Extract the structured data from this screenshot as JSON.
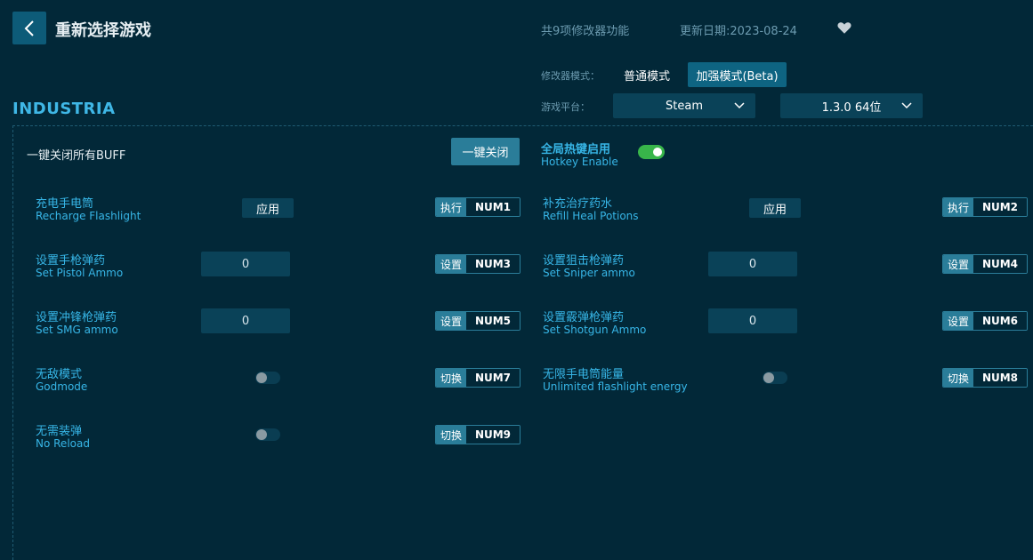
{
  "header": {
    "title": "重新选择游戏",
    "feature_count": "共9项修改器功能",
    "update_date": "更新日期:2023-08-24"
  },
  "mode": {
    "label": "修改器模式：",
    "normal": "普通模式",
    "enhanced": "加强模式(Beta)"
  },
  "platform": {
    "label": "游戏平台：",
    "selected": "Steam",
    "version": "1.3.0 64位"
  },
  "game_name": "INDUSTRIA",
  "disable_all": {
    "label": "一键关闭所有BUFF",
    "button": "一键关闭"
  },
  "hotkey_enable": {
    "cn": "全局热键启用",
    "en": "Hotkey Enable",
    "enabled": true
  },
  "apply_label": "应用",
  "options": [
    {
      "cn": "充电手电筒",
      "en": "Recharge Flashlight",
      "action": "执行",
      "key": "NUM1",
      "control": "apply"
    },
    {
      "cn": "补充治疗药水",
      "en": "Refill Heal Potions",
      "action": "执行",
      "key": "NUM2",
      "control": "apply"
    },
    {
      "cn": "设置手枪弹药",
      "en": "Set Pistol Ammo",
      "action": "设置",
      "key": "NUM3",
      "control": "input",
      "value": "0"
    },
    {
      "cn": "设置狙击枪弹药",
      "en": "Set Sniper ammo",
      "action": "设置",
      "key": "NUM4",
      "control": "input",
      "value": "0"
    },
    {
      "cn": "设置冲锋枪弹药",
      "en": "Set SMG ammo",
      "action": "设置",
      "key": "NUM5",
      "control": "input",
      "value": "0"
    },
    {
      "cn": "设置霰弹枪弹药",
      "en": "Set Shotgun Ammo",
      "action": "设置",
      "key": "NUM6",
      "control": "input",
      "value": "0"
    },
    {
      "cn": "无敌模式",
      "en": "Godmode",
      "action": "切换",
      "key": "NUM7",
      "control": "toggle",
      "enabled": false
    },
    {
      "cn": "无限手电筒能量",
      "en": "Unlimited flashlight energy",
      "action": "切换",
      "key": "NUM8",
      "control": "toggle",
      "enabled": false
    },
    {
      "cn": "无需装弹",
      "en": "No Reload",
      "action": "切换",
      "key": "NUM9",
      "control": "toggle",
      "enabled": false
    }
  ]
}
